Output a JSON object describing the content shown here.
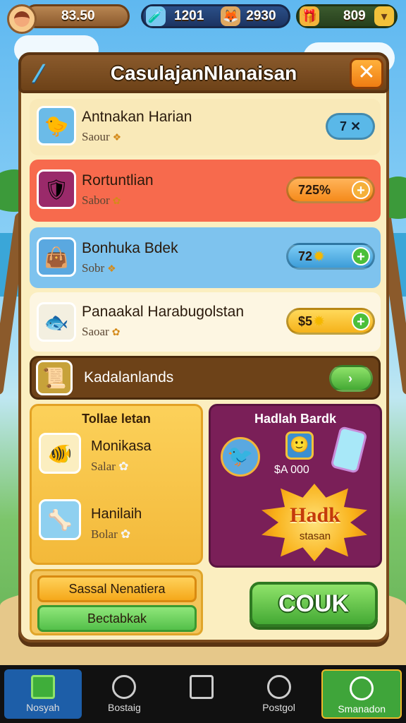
{
  "hud": {
    "coins": "83.50",
    "left_value": "1201",
    "right_value": "2930",
    "gems": "809"
  },
  "panel": {
    "title": "CasulajanNlanaisan",
    "rows": [
      {
        "title": "Antnakan Harian",
        "sub": "Saour",
        "action": "7 ✕",
        "color": "#f9e9b8",
        "action_color": "#5ab8e8"
      },
      {
        "title": "Rortuntlian",
        "sub": "Sabor",
        "action": "725%",
        "color": "#f76a4d",
        "action_color": "#f7a83c"
      },
      {
        "title": "Bonhuka Bdek",
        "sub": "Sobr",
        "action": "72",
        "color": "#7ec3ee",
        "action_color": "#5ab8e8"
      },
      {
        "title": "Panaakal Harabugolstan",
        "sub": "Saoar",
        "action": "$5",
        "color": "#fdf6e2",
        "action_color": "#f7c33c"
      }
    ],
    "banner": {
      "label": "Kadalanlands"
    }
  },
  "left_card": {
    "title": "Tollae letan",
    "items": [
      {
        "title": "Monikasa",
        "sub": "Salar"
      },
      {
        "title": "Hanilaih",
        "sub": "Bolar"
      }
    ]
  },
  "right_card": {
    "title": "Hadlah Bardk",
    "price": "$A 000",
    "promo": "Hadk",
    "promo_sub": "stasan"
  },
  "buttons": {
    "secondary_1": "Sassal Nenatiera",
    "secondary_2": "Bectabkak",
    "primary": "COUK"
  },
  "nav": [
    {
      "label": "Nosyah"
    },
    {
      "label": "Bostaig"
    },
    {
      "label": ""
    },
    {
      "label": "Postgol"
    },
    {
      "label": "Smanadon"
    }
  ]
}
